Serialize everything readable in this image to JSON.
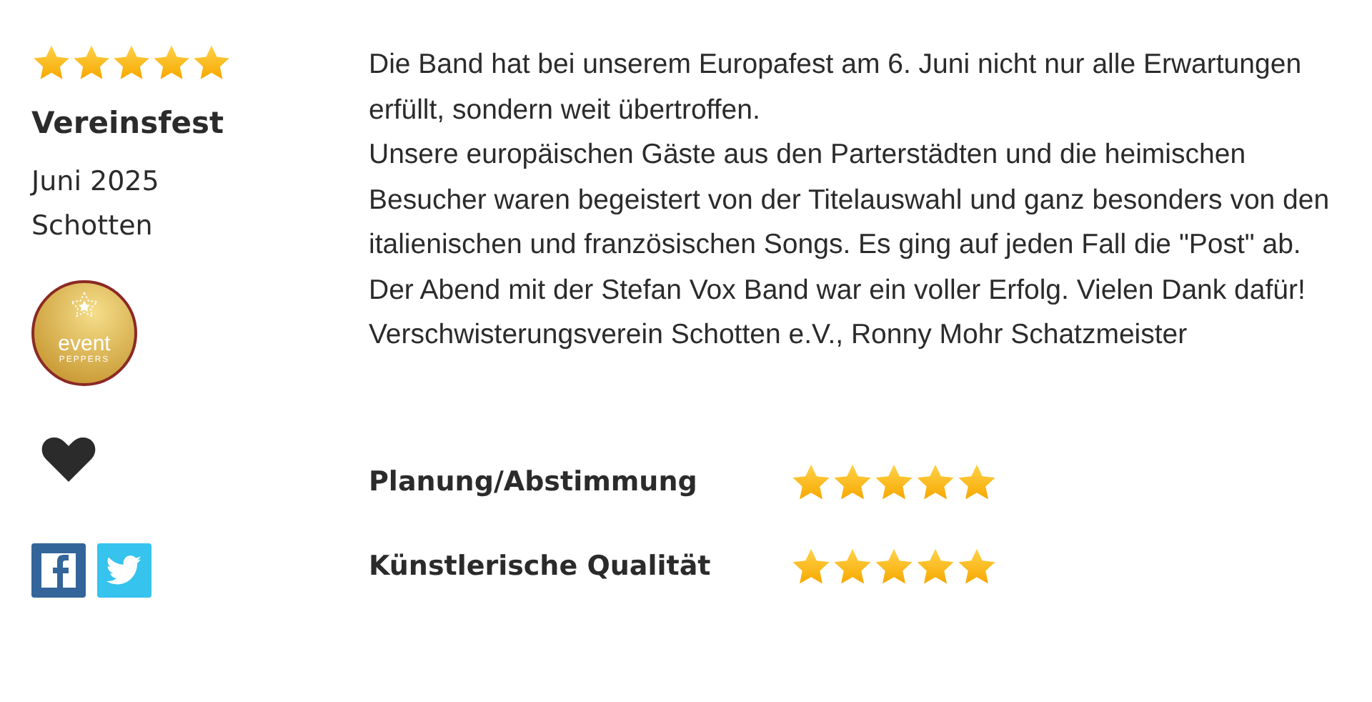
{
  "review": {
    "stars": 5,
    "event_type": "Vereinsfest",
    "date": "Juni 2025",
    "location": "Schotten",
    "badge": {
      "word": "event",
      "brand": "PEPPERS"
    },
    "paragraphs": [
      "Die Band hat bei unserem Europafest am 6. Juni nicht nur alle Erwartungen erfüllt, sondern weit übertroffen.",
      "Unsere europäischen Gäste aus den Parterstädten und die heimischen Besucher waren begeistert von der Titelauswahl und ganz besonders von den italienischen und französischen Songs. Es ging auf jeden Fall die \"Post\" ab.",
      "Der Abend mit der Stefan Vox Band war ein voller Erfolg. Vielen Dank dafür!",
      "Verschwisterungsverein Schotten e.V., Ronny Mohr Schatzmeister"
    ],
    "criteria": [
      {
        "label": "Planung/Abstimmung",
        "stars": 5
      },
      {
        "label": "Künstlerische Qualität",
        "stars": 5
      }
    ]
  }
}
